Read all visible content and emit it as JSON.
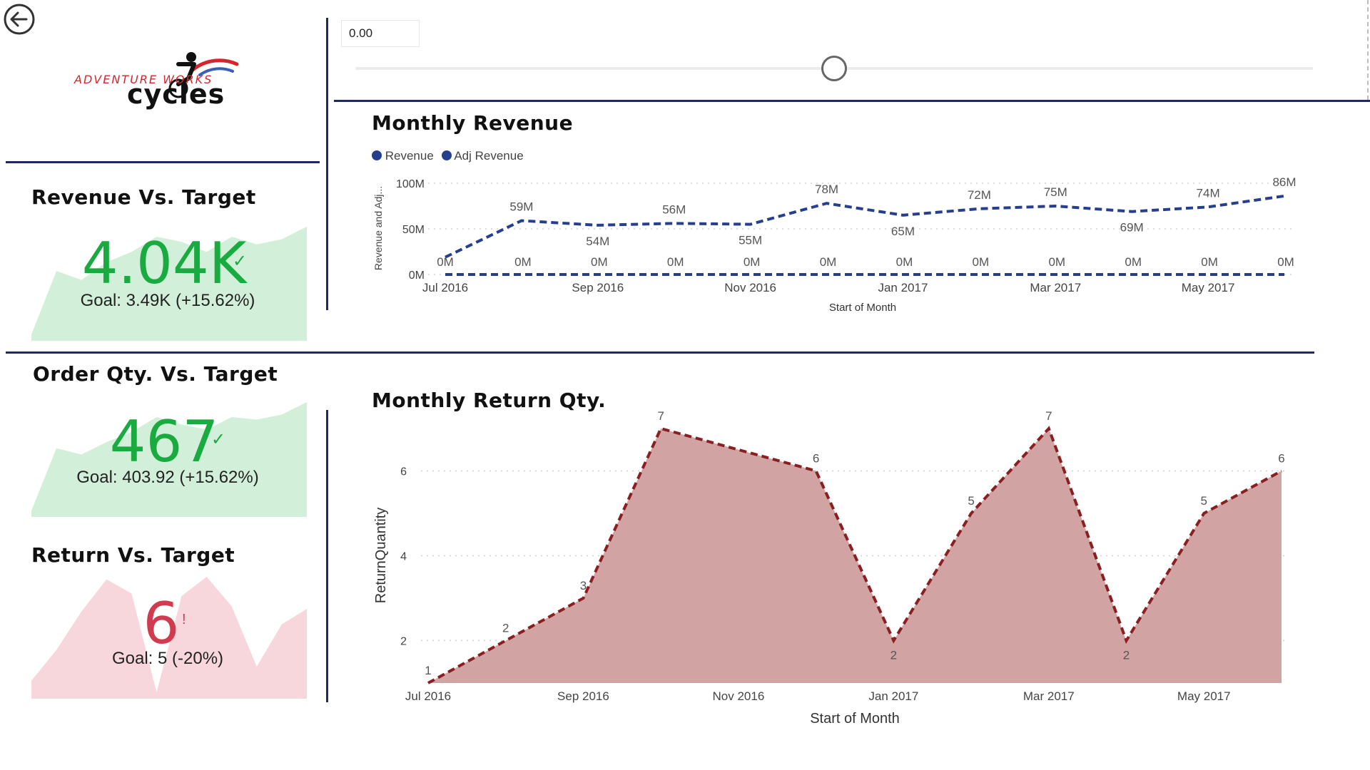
{
  "brand": {
    "line1": "ADVENTURE WORKS",
    "line2": "cycles"
  },
  "slider": {
    "value": "0.00",
    "position": 0.5
  },
  "kpis": {
    "revenue": {
      "title": "Revenue Vs. Target",
      "value": "4.04K",
      "goal": "Goal: 3.49K (+15.62%)",
      "mark": "✓",
      "status_color": "#1aab40",
      "fill_color": "#d2efd9"
    },
    "order_qty": {
      "title": "Order Qty. Vs. Target",
      "value": "467",
      "goal": "Goal: 403.92 (+15.62%)",
      "mark": "✓",
      "status_color": "#1aab40",
      "fill_color": "#d2efd9"
    },
    "returns": {
      "title": "Return Vs. Target",
      "value": "6",
      "goal": "Goal: 5 (-20%)",
      "mark": "!",
      "status_color": "#d13b4f",
      "fill_color": "#f8d7dc"
    }
  },
  "revenue_chart": {
    "title": "Monthly Revenue",
    "legend": [
      "Revenue",
      "Adj Revenue"
    ],
    "ylabel": "Revenue and Adj...",
    "xlabel": "Start of Month",
    "colors": {
      "series": "#253f8e",
      "legend_dot": "#253f8e"
    }
  },
  "returns_chart": {
    "title": "Monthly Return Qty.",
    "ylabel": "ReturnQuantity",
    "xlabel": "Start of Month",
    "colors": {
      "line": "#8a1f22",
      "fill": "#d1a4a3"
    }
  },
  "chart_data": [
    {
      "type": "line",
      "title": "Monthly Revenue",
      "xlabel": "Start of Month",
      "ylabel": "Revenue and Adj...",
      "categories": [
        "Jul 2016",
        "Aug 2016",
        "Sep 2016",
        "Oct 2016",
        "Nov 2016",
        "Dec 2016",
        "Jan 2017",
        "Feb 2017",
        "Mar 2017",
        "Apr 2017",
        "May 2017",
        "Jun 2017"
      ],
      "x_tick_labels": [
        "Jul 2016",
        "Sep 2016",
        "Nov 2016",
        "Jan 2017",
        "Mar 2017",
        "May 2017"
      ],
      "y_ticks": [
        "0M",
        "50M",
        "100M"
      ],
      "ylim": [
        0,
        100
      ],
      "unit": "M",
      "grid": true,
      "legend_position": "top-left",
      "series": [
        {
          "name": "Revenue",
          "values": [
            19,
            59,
            54,
            56,
            55,
            78,
            65,
            72,
            75,
            69,
            74,
            86
          ],
          "labels": [
            "",
            "59M",
            "54M",
            "56M",
            "55M",
            "78M",
            "65M",
            "72M",
            "75M",
            "69M",
            "74M",
            "86M"
          ]
        },
        {
          "name": "Adj Revenue",
          "values": [
            0,
            0,
            0,
            0,
            0,
            0,
            0,
            0,
            0,
            0,
            0,
            0
          ],
          "labels": [
            "0M",
            "0M",
            "0M",
            "0M",
            "0M",
            "0M",
            "0M",
            "0M",
            "0M",
            "0M",
            "0M",
            "0M"
          ]
        }
      ]
    },
    {
      "type": "area",
      "title": "Monthly Return Qty.",
      "xlabel": "Start of Month",
      "ylabel": "ReturnQuantity",
      "categories": [
        "Jul 2016",
        "Aug 2016",
        "Sep 2016",
        "Oct 2016",
        "Nov 2016",
        "Dec 2016",
        "Jan 2017",
        "Feb 2017",
        "Mar 2017",
        "Apr 2017",
        "May 2017",
        "Jun 2017"
      ],
      "x_tick_labels": [
        "Jul 2016",
        "Sep 2016",
        "Nov 2016",
        "Jan 2017",
        "Mar 2017",
        "May 2017"
      ],
      "y_ticks": [
        "2",
        "4",
        "6"
      ],
      "ylim": [
        1,
        7
      ],
      "grid": true,
      "series": [
        {
          "values": [
            1,
            2,
            3,
            7,
            6.5,
            6,
            2,
            5,
            7,
            2,
            5,
            6
          ],
          "labels": [
            "1",
            "2",
            "3",
            "7",
            "",
            "6",
            "2",
            "5",
            "7",
            "2",
            "5",
            "6"
          ]
        }
      ]
    },
    {
      "type": "area",
      "description_free": true,
      "series": [
        {
          "values": [
            0.05,
            0.55,
            0.48,
            0.62,
            0.7,
            0.82,
            0.78,
            0.7,
            0.82,
            0.76,
            0.8,
            0.9
          ]
        }
      ]
    },
    {
      "type": "area",
      "series": [
        {
          "values": [
            0.05,
            0.55,
            0.5,
            0.6,
            0.68,
            0.8,
            0.74,
            0.7,
            0.8,
            0.78,
            0.82,
            0.92
          ]
        }
      ]
    },
    {
      "type": "area",
      "series": [
        {
          "values": [
            0.14,
            0.38,
            0.68,
            0.93,
            0.82,
            0.05,
            0.8,
            0.95,
            0.72,
            0.25,
            0.58,
            0.7
          ]
        }
      ]
    }
  ]
}
